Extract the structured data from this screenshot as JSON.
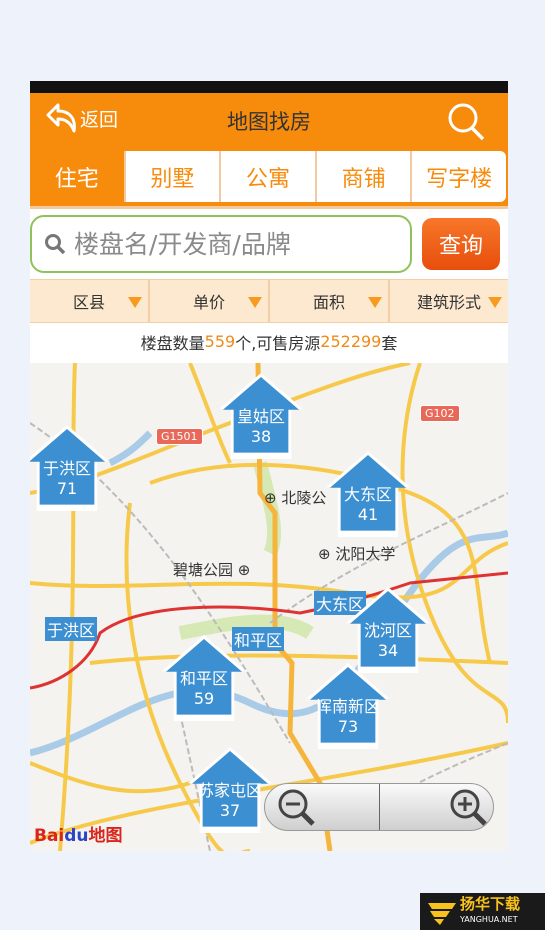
{
  "header": {
    "back_label": "返回",
    "title": "地图找房",
    "search_icon": "search-icon"
  },
  "tabs": [
    {
      "label": "住宅",
      "active": true
    },
    {
      "label": "别墅"
    },
    {
      "label": "公寓"
    },
    {
      "label": "商铺"
    },
    {
      "label": "写字楼"
    }
  ],
  "search": {
    "placeholder": "楼盘名/开发商/品牌",
    "button": "查询"
  },
  "filters": [
    "区县",
    "单价",
    "面积",
    "建筑形式"
  ],
  "count": {
    "prefix": "楼盘数量",
    "projects": "559",
    "mid": "个,可售房源",
    "units": "252299",
    "suffix": "套"
  },
  "map": {
    "markers": [
      {
        "name": "皇姑区",
        "count": "38"
      },
      {
        "name": "于洪区",
        "count": "71"
      },
      {
        "name": "大东区",
        "count": "41"
      },
      {
        "name": "沈河区",
        "count": "34"
      },
      {
        "name": "和平区",
        "count": "59"
      },
      {
        "name": "浑南新区",
        "count": "73"
      },
      {
        "name": "苏家屯区",
        "count": "37"
      }
    ],
    "places": [
      "北陵公",
      "沈阳大学",
      "碧塘公园"
    ],
    "district_labels": [
      "大东区",
      "于洪区",
      "和平区"
    ],
    "highways": [
      "G1501",
      "G102"
    ],
    "logo": "Baidu地图"
  },
  "colors": {
    "accent": "#f78b0c",
    "marker": "#3c8fd0",
    "number": "#f08a16"
  },
  "watermark": {
    "title": "扬华下载",
    "sub": "YANGHUA.NET"
  }
}
